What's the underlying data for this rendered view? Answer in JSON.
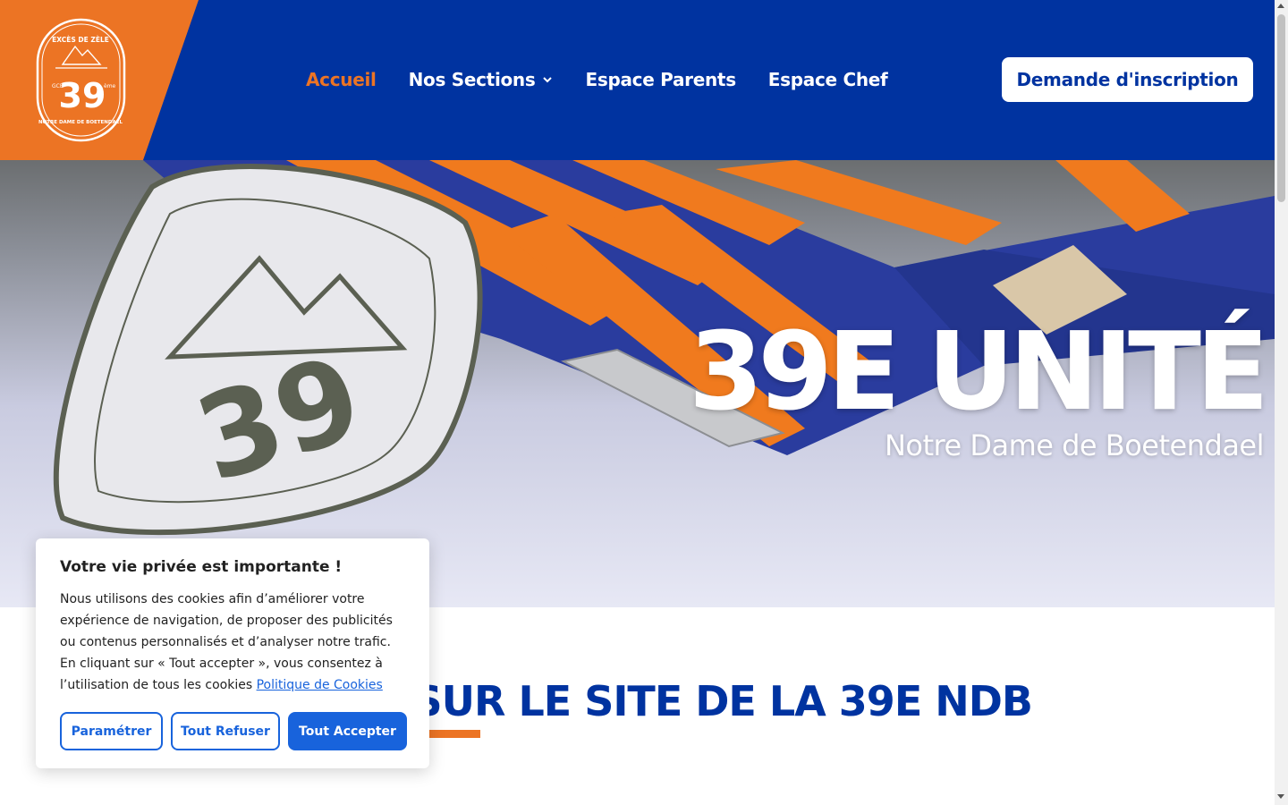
{
  "colors": {
    "brand_blue": "#0033a0",
    "brand_orange": "#ec7424",
    "cookie_blue": "#1863dc"
  },
  "logo": {
    "top_text": "EXCÈS DE ZÈLE",
    "number": "39",
    "left_text": "GCB",
    "right_text": "ème",
    "bottom_text": "NOTRE DAME DE BOETENDAEL"
  },
  "nav": {
    "items": [
      {
        "label": "Accueil",
        "active": true
      },
      {
        "label": "Nos Sections",
        "has_dropdown": true,
        "icon": "chevron-down-icon"
      },
      {
        "label": "Espace Parents"
      },
      {
        "label": "Espace Chef"
      }
    ],
    "cta_label": "Demande d'inscription"
  },
  "hero": {
    "title": "39E UNITÉ",
    "subtitle": "Notre Dame de Boetendael"
  },
  "welcome": {
    "title": "UE SUR LE SITE DE LA 39E NDB"
  },
  "cookie": {
    "title": "Votre vie privée est importante !",
    "text": "Nous utilisons des cookies afin d’améliorer votre expérience de navigation, de proposer des publicités ou contenus personnalisés et d’analyser notre trafic. En cliquant sur « Tout accepter », vous consentez à l’utilisation de tous les cookies",
    "policy_link": "Politique de Cookies",
    "buttons": {
      "settings": "Paramétrer",
      "refuse": "Tout Refuser",
      "accept": "Tout Accepter"
    }
  }
}
